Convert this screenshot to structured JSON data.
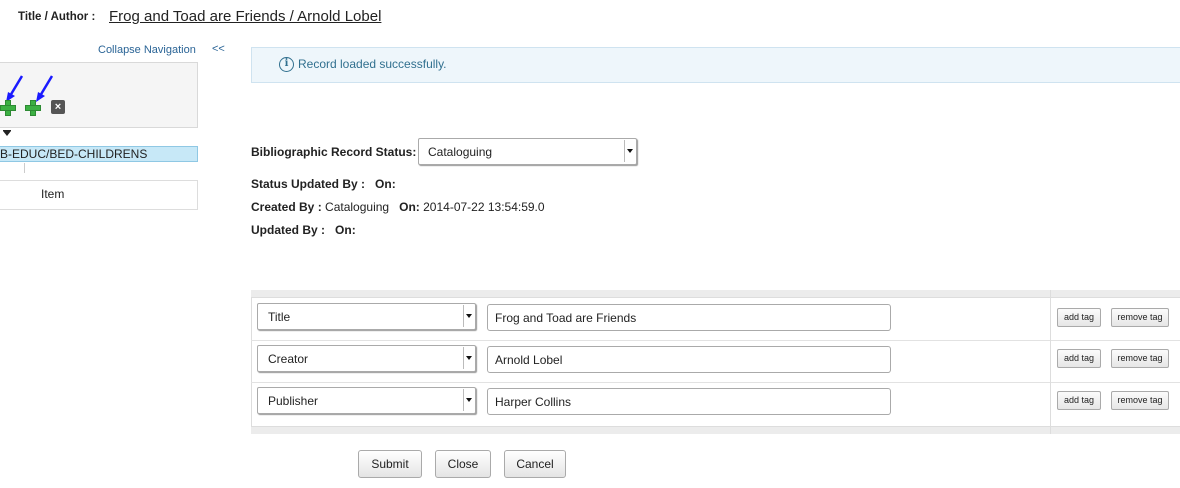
{
  "header": {
    "title_author_label": "Title / Author :",
    "title_author_value": "Frog and Toad are Friends / Arnold Lobel"
  },
  "nav": {
    "collapse_label": "Collapse Navigation",
    "collapse_arrows": "<<",
    "tree_selected": "B-EDUC/BED-CHILDRENS",
    "tree_item": "Item"
  },
  "alert": {
    "icon": "info-icon",
    "message": "Record loaded successfully."
  },
  "status": {
    "bib_status_label": "Bibliographic Record Status:",
    "bib_status_value": "Cataloguing",
    "status_updated_label": "Status Updated By :",
    "status_updated_on_label": "On:",
    "created_label": "Created By :",
    "created_value": "Cataloguing",
    "created_on_label": "On:",
    "created_on_value": "2014-07-22 13:54:59.0",
    "updated_label": "Updated By :",
    "updated_on_label": "On:"
  },
  "tags": {
    "rows": [
      {
        "tag": "Title",
        "value": "Frog and Toad are Friends"
      },
      {
        "tag": "Creator",
        "value": "Arnold Lobel"
      },
      {
        "tag": "Publisher",
        "value": "Harper Collins"
      }
    ],
    "add_label": "add tag",
    "remove_label": "remove tag"
  },
  "buttons": {
    "submit": "Submit",
    "close": "Close",
    "cancel": "Cancel"
  },
  "colors": {
    "link": "#2a6496",
    "alert_bg": "#eef6fb",
    "alert_text": "#31708f",
    "tree_selected_bg": "#c7e8f7",
    "plus_green": "#3cb043",
    "arrow_blue": "#1a1aff"
  }
}
